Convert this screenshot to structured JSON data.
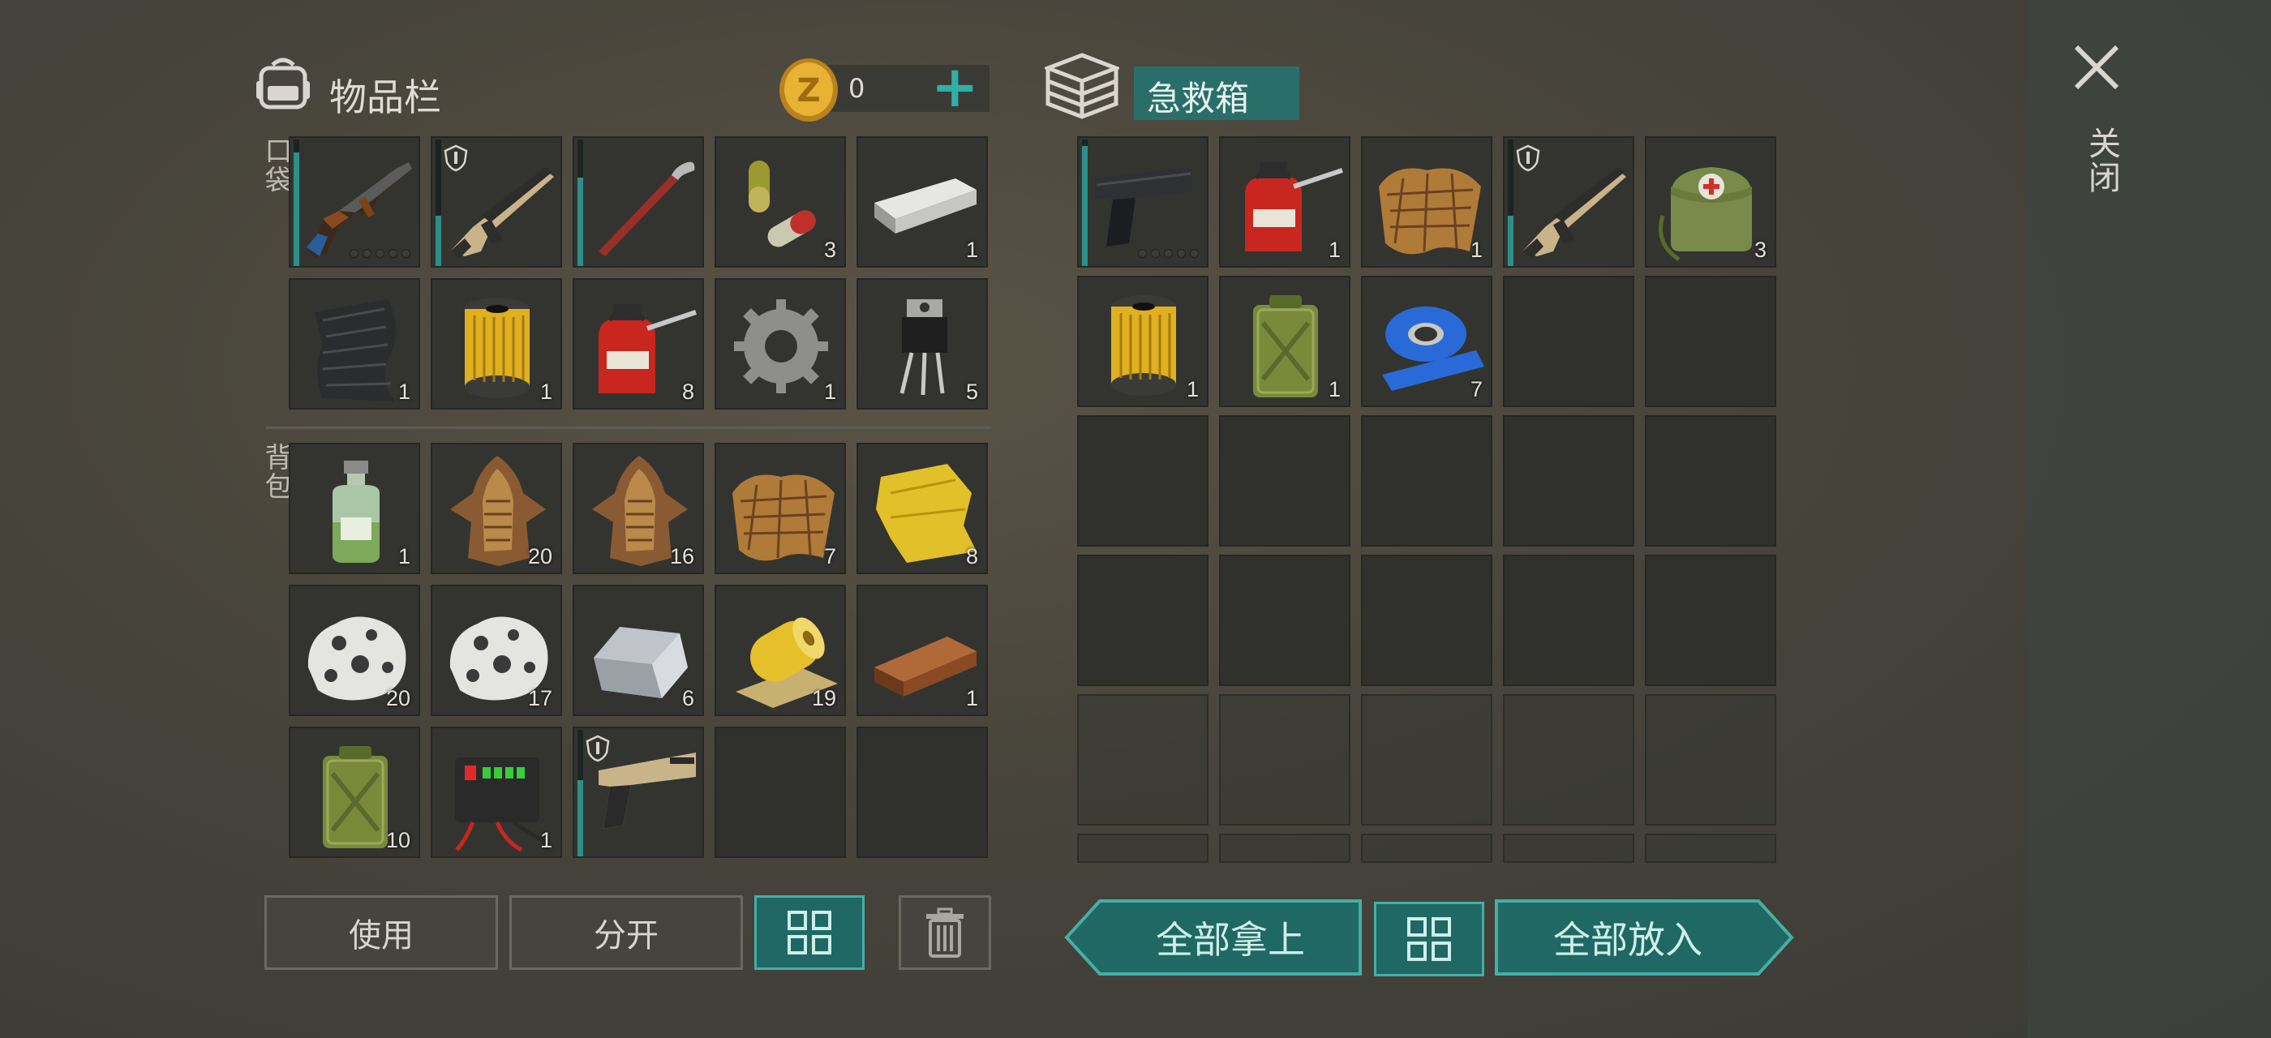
{
  "colors": {
    "accent": "#2e8f89",
    "teal_button": "#1f6864",
    "coin": "#e0a92a"
  },
  "inventory": {
    "title": "物品栏",
    "icon": "backpack-icon",
    "coins": "0",
    "add_label": "+",
    "pocket_label": "口袋",
    "backpack_label": "背包",
    "pocket_items": [
      {
        "icon": "assault-rifle-icon",
        "count": "",
        "durability": 0.9,
        "ammo": true
      },
      {
        "icon": "tan-rifle-icon",
        "count": "",
        "durability": 0.4,
        "shield": true
      },
      {
        "icon": "crowbar-icon",
        "count": "",
        "durability": 0.7
      },
      {
        "icon": "capsules-icon",
        "count": "3"
      },
      {
        "icon": "metal-bar-icon",
        "count": "1"
      },
      {
        "icon": "carbon-fabric-icon",
        "count": "1"
      },
      {
        "icon": "oil-filter-icon",
        "count": "1"
      },
      {
        "icon": "oil-can-icon",
        "count": "8"
      },
      {
        "icon": "gear-icon",
        "count": "1"
      },
      {
        "icon": "transistor-icon",
        "count": "5"
      }
    ],
    "backpack_items": [
      {
        "icon": "chemical-bottle-icon",
        "count": "1"
      },
      {
        "icon": "animal-hide-icon",
        "count": "20"
      },
      {
        "icon": "animal-hide-icon",
        "count": "16"
      },
      {
        "icon": "leather-icon",
        "count": "7"
      },
      {
        "icon": "yellow-cloth-icon",
        "count": "8"
      },
      {
        "icon": "stone-ore-icon",
        "count": "20"
      },
      {
        "icon": "stone-ore-icon",
        "count": "17"
      },
      {
        "icon": "iron-ingot-icon",
        "count": "6"
      },
      {
        "icon": "cloth-roll-icon",
        "count": "19"
      },
      {
        "icon": "wood-plank-icon",
        "count": "1"
      },
      {
        "icon": "jerrycan-icon",
        "count": "10"
      },
      {
        "icon": "car-battery-icon",
        "count": "1"
      },
      {
        "icon": "pistol-tan-icon",
        "count": "",
        "durability": 0.6,
        "shield": true
      },
      {
        "icon": "",
        "count": ""
      },
      {
        "icon": "",
        "count": ""
      }
    ],
    "use_label": "使用",
    "split_label": "分开",
    "sort_icon": "grid-sort-icon",
    "trash_icon": "trash-icon"
  },
  "container": {
    "title": "急救箱",
    "icon": "crate-icon",
    "items": [
      {
        "icon": "pistol-icon",
        "count": "",
        "durability": 0.95,
        "ammo": true
      },
      {
        "icon": "oil-can-icon",
        "count": "1"
      },
      {
        "icon": "leather-icon",
        "count": "1"
      },
      {
        "icon": "tan-rifle-icon",
        "count": "",
        "durability": 0.4,
        "shield": true
      },
      {
        "icon": "medkit-bag-icon",
        "count": "3"
      },
      {
        "icon": "oil-filter-icon",
        "count": "1"
      },
      {
        "icon": "jerrycan-icon",
        "count": "1"
      },
      {
        "icon": "duct-tape-icon",
        "count": "7"
      }
    ],
    "take_all_label": "全部拿上",
    "put_all_label": "全部放入",
    "sort_icon": "grid-sort-icon"
  },
  "close": {
    "label": "关闭",
    "icon": "close-icon"
  }
}
